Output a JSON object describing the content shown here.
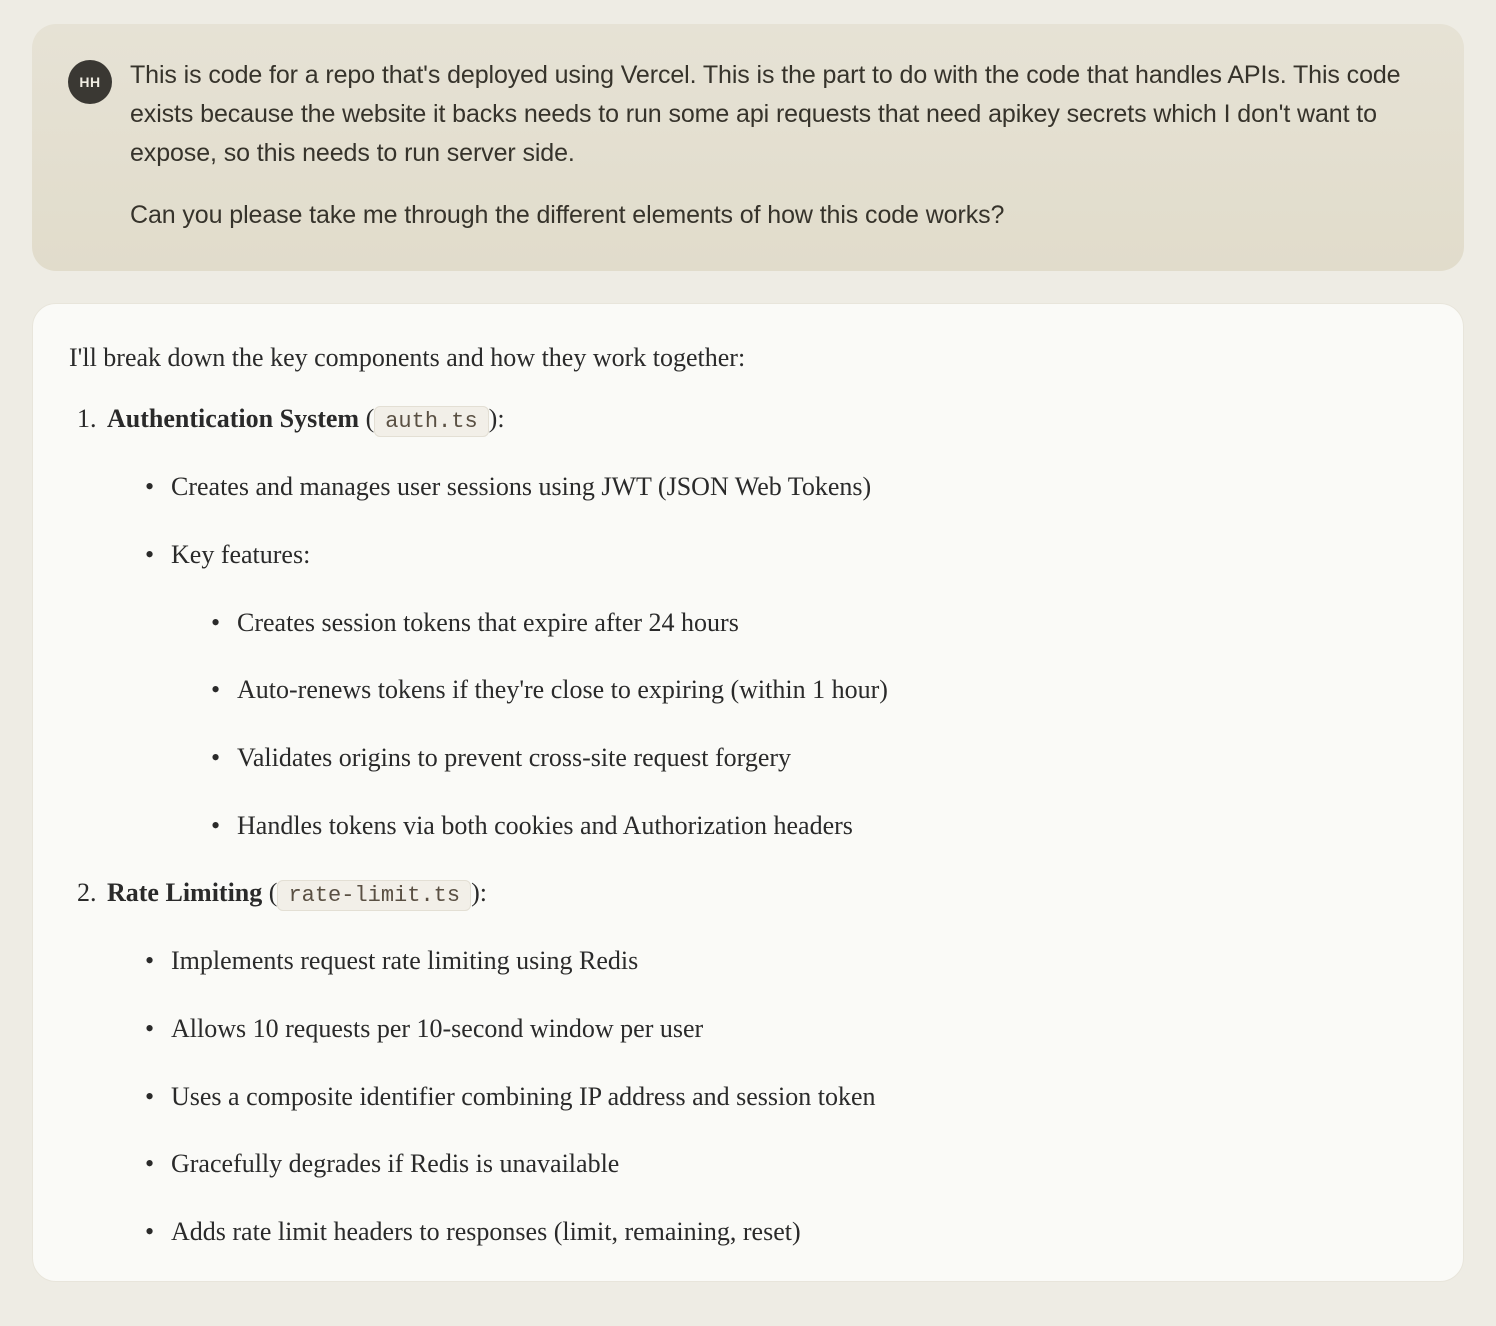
{
  "user": {
    "avatar": "HH",
    "paragraphs": [
      "This is code for a repo that's deployed using Vercel. This is the part to do with the code that handles APIs. This code exists because the website it backs needs to run some api requests that need apikey secrets which I don't want to expose, so this needs to run server side.",
      "Can you please take me through the different elements of how this code works?"
    ]
  },
  "assistant": {
    "intro": "I'll break down the key components and how they work together:",
    "sections": [
      {
        "num": "1.",
        "title": "Authentication System",
        "code": "auth.ts",
        "bullets_top": [
          "Creates and manages user sessions using JWT (JSON Web Tokens)",
          "Key features:"
        ],
        "bullets_sub": [
          "Creates session tokens that expire after 24 hours",
          "Auto-renews tokens if they're close to expiring (within 1 hour)",
          "Validates origins to prevent cross-site request forgery",
          "Handles tokens via both cookies and Authorization headers"
        ]
      },
      {
        "num": "2.",
        "title": "Rate Limiting",
        "code": "rate-limit.ts",
        "bullets_top": [
          "Implements request rate limiting using Redis",
          "Allows 10 requests per 10-second window per user",
          "Uses a composite identifier combining IP address and session token",
          "Gracefully degrades if Redis is unavailable",
          "Adds rate limit headers to responses (limit, remaining, reset)"
        ],
        "bullets_sub": []
      }
    ]
  }
}
